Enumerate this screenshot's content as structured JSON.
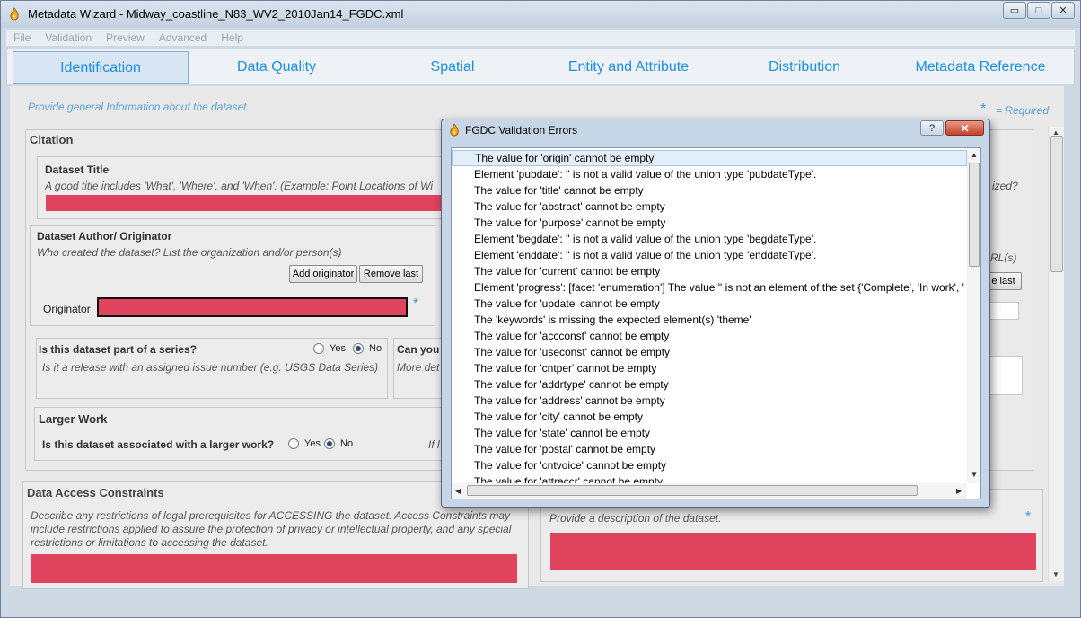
{
  "window": {
    "title": "Metadata Wizard - Midway_coastline_N83_WV2_2010Jan14_FGDC.xml",
    "minimize": "▭",
    "maximize": "□",
    "close": "✕"
  },
  "menu": [
    "File",
    "Validation",
    "Preview",
    "Advanced",
    "Help"
  ],
  "tabs": [
    "Identification",
    "Data Quality",
    "Spatial",
    "Entity and Attribute",
    "Distribution",
    "Metadata Reference"
  ],
  "page": {
    "intro": "Provide general Information about the dataset.",
    "required_star": "*",
    "required_text": "= Required",
    "citation": {
      "title": "Citation",
      "dataset_title_label": "Dataset Title",
      "dataset_title_hint": "A good title includes 'What', 'Where', and 'When'.  (Example: Point Locations of Wi",
      "author_label": "Dataset Author/ Originator",
      "author_hint": "Who created the dataset? List the organization and/or person(s)",
      "add_originator": "Add originator",
      "remove_last": "Remove last",
      "originator_label": "Originator",
      "series_question": "Is this dataset part of a series?",
      "series_hint": "Is it a release with an assigned issue number (e.g. USGS Data Series)",
      "yes": "Yes",
      "no": "No",
      "can_label": "Can you",
      "more_details": "More det",
      "larger_work_title": "Larger Work",
      "larger_work_question": "Is this dataset associated with a larger work?",
      "if_label": "If l",
      "right_partial_1": "ized?",
      "right_partial_2": "RL(s)",
      "right_remove_last": "e last"
    },
    "access": {
      "title": "Data Access Constraints",
      "description": "Describe any restrictions of legal prerequisites for ACCESSING the dataset.  Access Constraints may include restrictions applied to assure the protection of privacy or intellectual property, and any special restrictions or limitations to accessing the dataset."
    },
    "description_hint": "Provide a description of the dataset."
  },
  "dialog": {
    "title": "FGDC Validation Errors",
    "help": "?",
    "close": "✕",
    "errors": [
      "The value for 'origin' cannot be empty",
      "Element 'pubdate': '' is not a valid value of the union type 'pubdateType'.",
      "The value for 'title' cannot be empty",
      "The value for 'abstract' cannot be empty",
      "The value for 'purpose' cannot be empty",
      "Element 'begdate': '' is not a valid value of the union type 'begdateType'.",
      "Element 'enddate': '' is not a valid value of the union type 'enddateType'.",
      "The value for 'current' cannot be empty",
      "Element 'progress': [facet 'enumeration'] The value '' is not an element of the set {'Complete', 'In work', '",
      "The value for 'update' cannot be empty",
      "The 'keywords' is missing the expected element(s) 'theme'",
      "The value for 'accconst' cannot be empty",
      "The value for 'useconst' cannot be empty",
      "The value for 'cntper' cannot be empty",
      "The value for 'addrtype' cannot be empty",
      "The value for 'address' cannot be empty",
      "The value for 'city' cannot be empty",
      "The value for 'state' cannot be empty",
      "The value for 'postal' cannot be empty",
      "The value for 'cntvoice' cannot be empty",
      "The value for 'attraccr' cannot be empty"
    ]
  },
  "colors": {
    "accent": "#1c8fe0",
    "required_field": "#e0435e",
    "hint": "#5aa0d8"
  }
}
